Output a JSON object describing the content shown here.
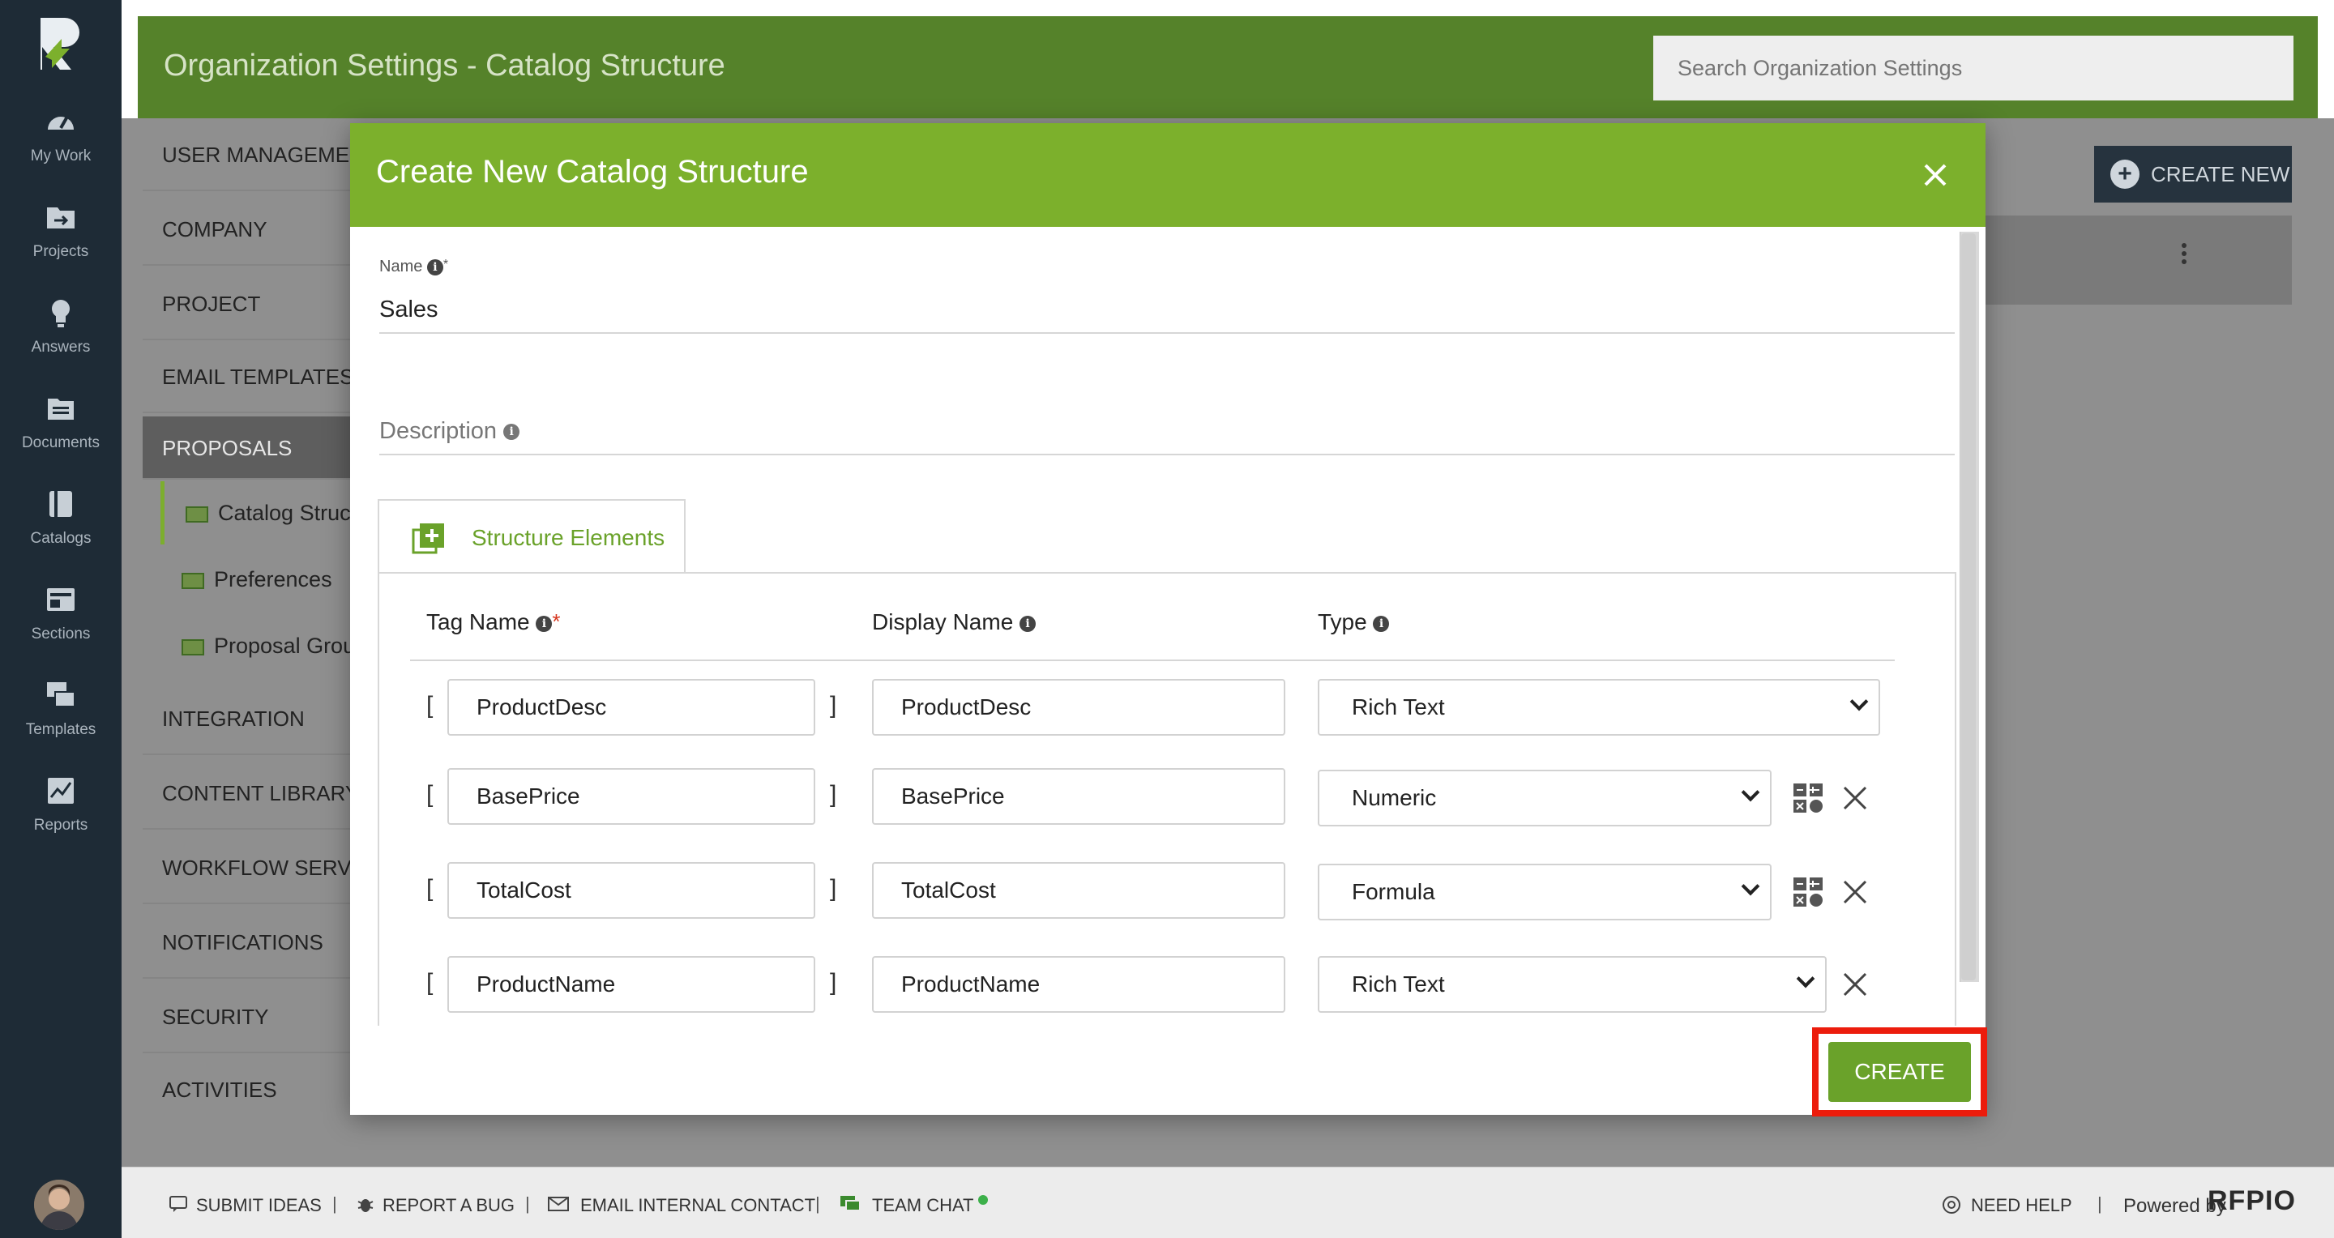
{
  "rail": {
    "items": [
      {
        "label": "My Work",
        "icon": "gauge-icon"
      },
      {
        "label": "Projects",
        "icon": "projects-folder-icon"
      },
      {
        "label": "Answers",
        "icon": "lightbulb-icon"
      },
      {
        "label": "Documents",
        "icon": "documents-icon"
      },
      {
        "label": "Catalogs",
        "icon": "catalog-book-icon"
      },
      {
        "label": "Sections",
        "icon": "sections-icon"
      },
      {
        "label": "Templates",
        "icon": "templates-icon"
      },
      {
        "label": "Reports",
        "icon": "reports-chart-icon"
      }
    ]
  },
  "header": {
    "title": "Organization Settings - Catalog Structure",
    "search_placeholder": "Search Organization Settings"
  },
  "settings_nav": {
    "items": [
      "USER MANAGEMENT",
      "COMPANY",
      "PROJECT",
      "EMAIL TEMPLATES",
      "PROPOSALS",
      "INTEGRATION",
      "CONTENT LIBRARY",
      "WORKFLOW SERVICES",
      "NOTIFICATIONS",
      "SECURITY",
      "ACTIVITIES"
    ],
    "sub_items": [
      "Catalog Structure",
      "Preferences",
      "Proposal Groups"
    ]
  },
  "create_new_label": "CREATE NEW",
  "modal": {
    "title": "Create New Catalog Structure",
    "name_label": "Name",
    "name_value": "Sales",
    "description_label": "Description",
    "tab_label": "Structure Elements",
    "columns": {
      "tag": "Tag Name",
      "display": "Display Name",
      "type": "Type"
    },
    "rows": [
      {
        "tag": "ProductDesc",
        "display": "ProductDesc",
        "type": "Rich Text"
      },
      {
        "tag": "BasePrice",
        "display": "BasePrice",
        "type": "Numeric"
      },
      {
        "tag": "TotalCost",
        "display": "TotalCost",
        "type": "Formula"
      },
      {
        "tag": "ProductName",
        "display": "ProductName",
        "type": "Rich Text"
      }
    ],
    "create_label": "CREATE",
    "bracket_open": "[",
    "bracket_close": "]"
  },
  "footer": {
    "submit_ideas": "SUBMIT IDEAS",
    "report_bug": "REPORT A BUG",
    "email_contact": "EMAIL INTERNAL CONTACT",
    "team_chat": "TEAM CHAT",
    "need_help": "NEED HELP",
    "powered_by": "Powered by",
    "brand": "RFPIO",
    "sep": "|"
  },
  "colors": {
    "header": "#55822a",
    "modal_header": "#7cb02c",
    "accent": "#6aa22a",
    "rail": "#1e2b36",
    "highlight": "#ec1c0c"
  }
}
